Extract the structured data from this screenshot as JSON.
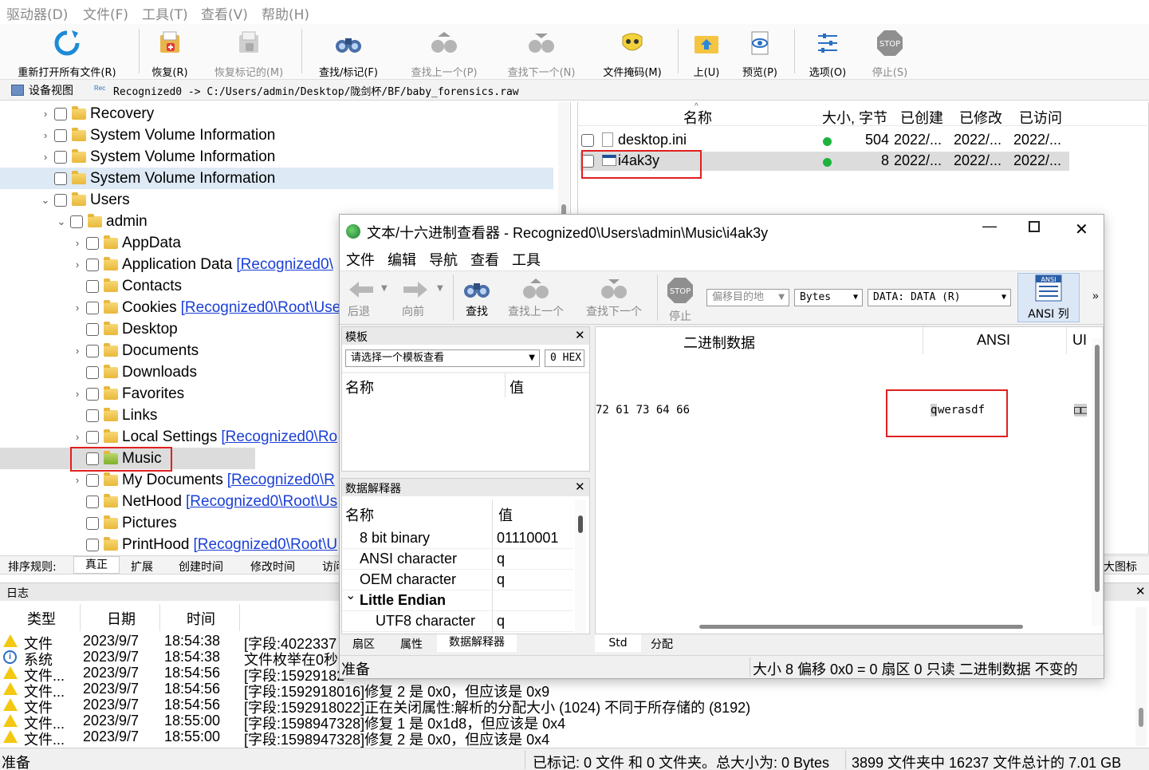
{
  "menubar": [
    "驱动器(D)",
    "文件(F)",
    "工具(T)",
    "查看(V)",
    "帮助(H)"
  ],
  "toolbar": {
    "reopen": "重新打开所有文件(R)",
    "recover": "恢复(R)",
    "recover_marked": "恢复标记的(M)",
    "find_mark": "查找/标记(F)",
    "find_prev": "查找上一个(P)",
    "find_next": "查找下一个(N)",
    "file_mask": "文件掩码(M)",
    "up": "上(U)",
    "preview": "预览(P)",
    "options": "选项(O)",
    "stop": "停止(S)",
    "stop_icon_text": "STOP"
  },
  "pathbar": {
    "device_view": "设备视图",
    "rec_icon_text": "Rec",
    "path": "Recognized0 -> C:/Users/admin/Desktop/陇剑杯/BF/baby_forensics.raw"
  },
  "tree": {
    "items": [
      {
        "label": "Recovery",
        "link": ""
      },
      {
        "label": "System Volume Information",
        "link": ""
      },
      {
        "label": "System Volume Information",
        "link": ""
      },
      {
        "label": "System Volume Information",
        "link": ""
      },
      {
        "label": "Users",
        "link": ""
      },
      {
        "label": "admin",
        "link": ""
      },
      {
        "label": "AppData",
        "link": ""
      },
      {
        "label": "Application Data",
        "link": "[Recognized0\\"
      },
      {
        "label": "Contacts",
        "link": ""
      },
      {
        "label": "Cookies",
        "link": "[Recognized0\\Root\\Use"
      },
      {
        "label": "Desktop",
        "link": ""
      },
      {
        "label": "Documents",
        "link": ""
      },
      {
        "label": "Downloads",
        "link": ""
      },
      {
        "label": "Favorites",
        "link": ""
      },
      {
        "label": "Links",
        "link": ""
      },
      {
        "label": "Local Settings",
        "link": "[Recognized0\\Ro"
      },
      {
        "label": "Music",
        "link": ""
      },
      {
        "label": "My Documents",
        "link": "[Recognized0\\R"
      },
      {
        "label": "NetHood",
        "link": "[Recognized0\\Root\\Us"
      },
      {
        "label": "Pictures",
        "link": ""
      },
      {
        "label": "PrintHood",
        "link": "[Recognized0\\Root\\U"
      }
    ]
  },
  "sortbar": {
    "label": "排序规则:",
    "items": [
      "真正",
      "扩展",
      "创建时间",
      "修改时间",
      "访问"
    ],
    "right": "大图标"
  },
  "filelist": {
    "headers": [
      "名称",
      "大小, 字节",
      "已创建",
      "已修改",
      "已访问"
    ],
    "rows": [
      {
        "name": "desktop.ini",
        "size": "504",
        "created": "2022/...",
        "modified": "2022/...",
        "accessed": "2022/..."
      },
      {
        "name": "i4ak3y",
        "size": "8",
        "created": "2022/...",
        "modified": "2022/...",
        "accessed": "2022/..."
      }
    ]
  },
  "log": {
    "title": "日志",
    "headers": [
      "类型",
      "日期",
      "时间"
    ],
    "rows": [
      {
        "type": "文件",
        "icon": "warn",
        "date": "2023/9/7",
        "time": "18:54:38",
        "text": "[字段:4022337"
      },
      {
        "type": "系统",
        "icon": "info",
        "date": "2023/9/7",
        "time": "18:54:38",
        "text": "文件枚举在0秒"
      },
      {
        "type": "文件...",
        "icon": "warn",
        "date": "2023/9/7",
        "time": "18:54:56",
        "text": "[字段:15929182"
      },
      {
        "type": "文件...",
        "icon": "warn",
        "date": "2023/9/7",
        "time": "18:54:56",
        "text": "[字段:1592918016]修复 2 是 0x0，但应该是 0x9"
      },
      {
        "type": "文件",
        "icon": "warn",
        "date": "2023/9/7",
        "time": "18:54:56",
        "text": "[字段:1592918022]正在关闭属性:解析的分配大小 (1024) 不同于所存储的 (8192)"
      },
      {
        "type": "文件...",
        "icon": "warn",
        "date": "2023/9/7",
        "time": "18:55:00",
        "text": "[字段:1598947328]修复 1 是 0x1d8，但应该是 0x4"
      },
      {
        "type": "文件...",
        "icon": "warn",
        "date": "2023/9/7",
        "time": "18:55:00",
        "text": "[字段:1598947328]修复 2 是 0x0，但应该是 0x4"
      }
    ]
  },
  "statusbar": {
    "left": "准备",
    "marked": "已标记:  0 文件 和 0 文件夹。总大小为: 0 Bytes",
    "total": "3899 文件夹中 16237 文件总计的 7.01 GB"
  },
  "viewer": {
    "title": "文本/十六进制查看器 - Recognized0\\Users\\admin\\Music\\i4ak3y",
    "menu": [
      "文件",
      "编辑",
      "导航",
      "查看",
      "工具"
    ],
    "toolbar": {
      "back": "后退",
      "forward": "向前",
      "find": "查找",
      "find_prev": "查找上一个",
      "find_next": "查找下一个",
      "stop": "停止",
      "stop_icon_text": "STOP",
      "ansi_col": "ANSI 列",
      "ansi_icon_text": "ANSI",
      "more": "»"
    },
    "offset_placeholder": "偏移目的地",
    "unit": "Bytes",
    "stream": "DATA: DATA (R)",
    "template_panel": {
      "title": "模板",
      "select": "请选择一个模板查看",
      "hex": "0 HEX",
      "col_name": "名称",
      "col_value": "值"
    },
    "interp_panel": {
      "title": "数据解释器",
      "col_name": "名称",
      "col_value": "值",
      "rows": [
        {
          "name": "8 bit binary",
          "value": "01110001"
        },
        {
          "name": "ANSI character",
          "value": "q"
        },
        {
          "name": "OEM character",
          "value": "q"
        },
        {
          "name": "Little Endian",
          "value": ""
        },
        {
          "name": "UTF8 character",
          "value": "q"
        }
      ]
    },
    "hex_headers": {
      "binary": "二进制数据",
      "ansi": "ANSI",
      "uni": "UI"
    },
    "hex_bytes": "72 61 73 64 66",
    "ansi_first": "q",
    "ansi_rest": "werasdf",
    "uni_text": "□□",
    "bottom_tabs": [
      "扇区",
      "属性",
      "数据解释器"
    ],
    "bottom_tabs_right": [
      "Std",
      "分配"
    ],
    "status_left": "准备",
    "status_right": "大小 8  偏移 0x0 = 0  扇区 0  只读  二进制数据  不变的"
  }
}
